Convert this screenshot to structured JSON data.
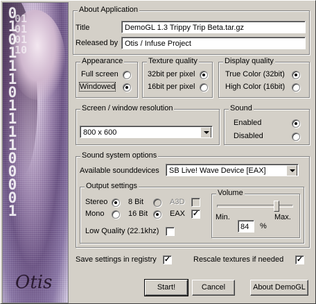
{
  "banner": {
    "logo": "Otis",
    "binary": "0101110111100001",
    "binary2": "01010110"
  },
  "about": {
    "group_title": "About Application",
    "title_label": "Title",
    "title_value": "DemoGL 1.3 Trippy Trip Beta.tar.gz",
    "released_label": "Released by",
    "released_value": "Otis / Infuse Project"
  },
  "appearance": {
    "title": "Appearance",
    "options": [
      "Full screen",
      "Windowed"
    ],
    "selected": "Windowed"
  },
  "texture_quality": {
    "title": "Texture quality",
    "options": [
      "32bit per pixel",
      "16bit per pixel"
    ],
    "selected": "32bit per pixel"
  },
  "display_quality": {
    "title": "Display quality",
    "options": [
      "True Color (32bit)",
      "High Color (16bit)"
    ],
    "selected": "True Color (32bit)"
  },
  "resolution": {
    "title": "Screen / window resolution",
    "value": "800 x 600"
  },
  "sound": {
    "title": "Sound",
    "options": [
      "Enabled",
      "Disabled"
    ],
    "selected": "Enabled"
  },
  "sound_system": {
    "title": "Sound system options",
    "devices_label": "Available sounddevices",
    "device_value": "SB Live! Wave Device [EAX]",
    "output": {
      "title": "Output settings",
      "stereo": "Stereo",
      "mono": "Mono",
      "bit8": "8 Bit",
      "bit16": "16 Bit",
      "a3d": "A3D",
      "eax": "EAX",
      "low_quality": "Low Quality (22.1khz)",
      "channel_selected": "Stereo",
      "bits_selected": "16 Bit",
      "eax_checked": true,
      "a3d_checked": false,
      "low_quality_checked": false
    },
    "volume": {
      "title": "Volume",
      "min": "Min.",
      "max": "Max.",
      "value": "84",
      "unit": "%",
      "level": 0.84
    }
  },
  "footer": {
    "save_registry": "Save settings in registry",
    "save_registry_checked": true,
    "rescale": "Rescale textures if needed",
    "rescale_checked": true
  },
  "buttons": {
    "start": "Start!",
    "cancel": "Cancel",
    "about": "About DemoGL"
  },
  "colors": {
    "face": "#d4d0c8",
    "shadow": "#808080",
    "highlight": "#ffffff"
  }
}
